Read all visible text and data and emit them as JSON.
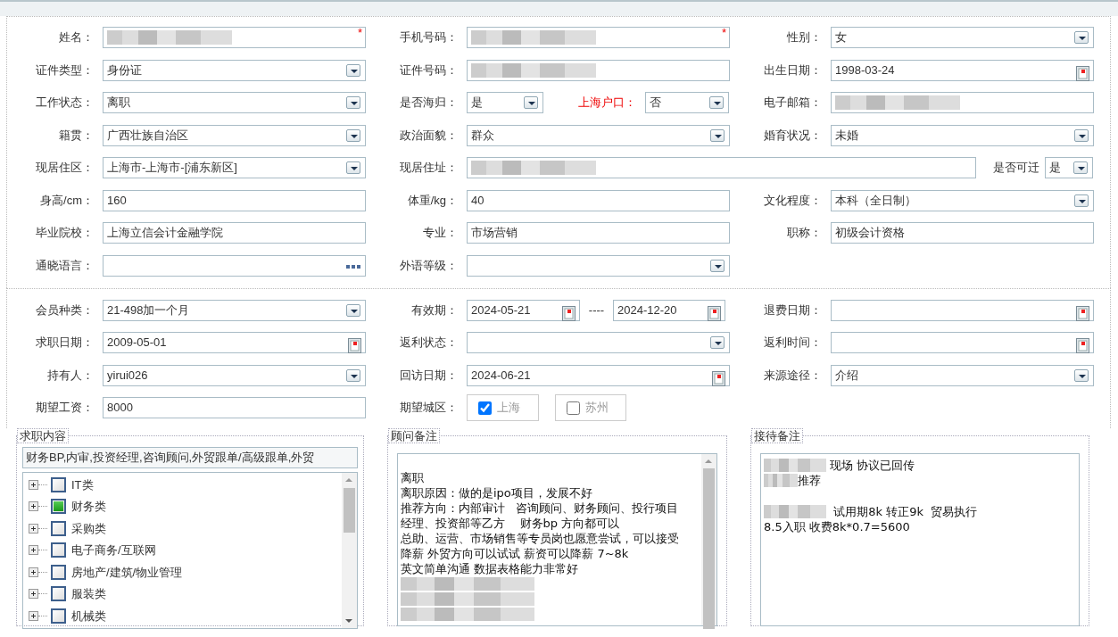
{
  "basic_info": {
    "rows": [
      {
        "kind": "standard",
        "fields": [
          {
            "label": "姓名：",
            "kind": "text",
            "redacted": true,
            "required_mark": "*"
          },
          {
            "label": "手机号码：",
            "kind": "text",
            "redacted": true,
            "required_mark": "*"
          },
          {
            "label": "性别：",
            "kind": "select",
            "value": "女"
          }
        ]
      },
      {
        "kind": "standard",
        "fields": [
          {
            "label": "证件类型：",
            "kind": "select",
            "value": "身份证"
          },
          {
            "label": "证件号码：",
            "kind": "text",
            "redacted": true
          },
          {
            "label": "出生日期：",
            "kind": "date",
            "value": "1998-03-24"
          }
        ]
      },
      {
        "kind": "hukou",
        "fields": [
          {
            "label": "工作状态：",
            "kind": "select",
            "value": "离职",
            "highlighted": false
          },
          {
            "label": "是否海归：",
            "kind": "select",
            "value": "是",
            "highlighted": false
          },
          {
            "label": "上海户口：",
            "kind": "select",
            "value": "否",
            "highlighted": true
          },
          {
            "label": "电子邮箱：",
            "kind": "text",
            "redacted": true,
            "highlighted": false
          }
        ]
      },
      {
        "kind": "standard",
        "fields": [
          {
            "label": "籍贯：",
            "kind": "select",
            "value": "广西壮族自治区"
          },
          {
            "label": "政治面貌：",
            "kind": "select",
            "value": "群众"
          },
          {
            "label": "婚育状况：",
            "kind": "select",
            "value": "未婚"
          }
        ]
      },
      {
        "kind": "address",
        "fields": [
          {
            "label": "现居住区：",
            "kind": "select",
            "value": "上海市-上海市-[浦东新区]"
          },
          {
            "label": "现居住址：",
            "kind": "text",
            "redacted": true
          },
          {
            "label": "是否可迁",
            "kind": "select",
            "value": "是"
          }
        ]
      },
      {
        "kind": "standard",
        "fields": [
          {
            "label": "身高/cm：",
            "kind": "text",
            "value": "160"
          },
          {
            "label": "体重/kg：",
            "kind": "text",
            "value": "40"
          },
          {
            "label": "文化程度：",
            "kind": "select",
            "value": "本科（全日制）"
          }
        ]
      },
      {
        "kind": "standard",
        "fields": [
          {
            "label": "毕业院校：",
            "kind": "text",
            "value": "上海立信会计金融学院"
          },
          {
            "label": "专业：",
            "kind": "text",
            "value": "市场营销"
          },
          {
            "label": "职称：",
            "kind": "text",
            "value": "初级会计资格"
          }
        ]
      },
      {
        "kind": "standard",
        "fields": [
          {
            "label": "通晓语言：",
            "kind": "picker"
          },
          {
            "label": "外语等级：",
            "kind": "select"
          }
        ]
      }
    ]
  },
  "membership": {
    "rows": [
      {
        "kind": "validity",
        "fields": [
          {
            "label": "会员种类：",
            "kind": "select",
            "value": "21-498加一个月"
          },
          {
            "label": "有效期：",
            "kind": "date",
            "value": "2024-05-21",
            "separator": "----",
            "end_value": "2024-12-20"
          },
          {
            "label": "退费日期：",
            "kind": "date"
          }
        ]
      },
      {
        "kind": "standard",
        "fields": [
          {
            "label": "求职日期：",
            "kind": "date",
            "value": "2009-05-01"
          },
          {
            "label": "返利状态：",
            "kind": "select"
          },
          {
            "label": "返利时间：",
            "kind": "date"
          }
        ]
      },
      {
        "kind": "standard",
        "fields": [
          {
            "label": "持有人：",
            "kind": "select",
            "value": "yirui026"
          },
          {
            "label": "回访日期：",
            "kind": "date",
            "value": "2024-06-21"
          },
          {
            "label": "来源途径：",
            "kind": "select",
            "value": "介绍"
          }
        ]
      },
      {
        "kind": "cities",
        "fields": [
          {
            "label": "期望工资：",
            "kind": "text",
            "value": "8000"
          },
          {
            "label": "期望城区：",
            "kind": "options",
            "options": [
              {
                "label": "上海",
                "checked": true
              },
              {
                "label": "苏州",
                "checked": false
              }
            ]
          }
        ]
      }
    ]
  },
  "panels": [
    {
      "kind": "tree",
      "legend": "求职内容",
      "summary": "财务BP,内审,投资经理,咨询顾问,外贸跟单/高级跟单,外贸",
      "items": [
        {
          "label": "IT类",
          "checked": false
        },
        {
          "label": "财务类",
          "checked": true
        },
        {
          "label": "采购类",
          "checked": false
        },
        {
          "label": "电子商务/互联网",
          "checked": false
        },
        {
          "label": "房地产/建筑/物业管理",
          "checked": false
        },
        {
          "label": "服装类",
          "checked": false
        },
        {
          "label": "机械类",
          "checked": false
        }
      ]
    },
    {
      "kind": "notes",
      "legend": "顾问备注",
      "paragraphs": [
        [
          {
            "redacted": false,
            "text": "离职"
          },
          {
            "redacted": false,
            "text": "离职原因：做的是ipo项目，发展不好"
          },
          {
            "redacted": false,
            "text": "推荐方向：内部审计   咨询顾问、财务顾问、投行项目"
          },
          {
            "redacted": false,
            "text": "经理、投资部等乙方    财务bp 方向都可以"
          },
          {
            "redacted": false,
            "text": "总助、运营、市场销售等专员岗也愿意尝试，可以接受"
          },
          {
            "redacted": false,
            "text": "降薪 外贸方向可以试试 薪资可以降薪 7~8k"
          },
          {
            "redacted": false,
            "text": "英文简单沟通 数据表格能力非常好"
          },
          {
            "redacted": true
          },
          {
            "redacted": true
          },
          {
            "redacted": true
          }
        ]
      ]
    },
    {
      "kind": "notes",
      "legend": "接待备注",
      "paragraphs": [
        [
          {
            "redacted": true,
            "text": " 现场 协议已回传"
          },
          {
            "redacted": true,
            "text": "推荐"
          }
        ],
        [
          {
            "redacted": true,
            "text": "  试用期8k 转正9k  贸易执行"
          },
          {
            "redacted": false,
            "text": "8.5入职 收费8k*0.7=5600"
          }
        ]
      ]
    }
  ]
}
